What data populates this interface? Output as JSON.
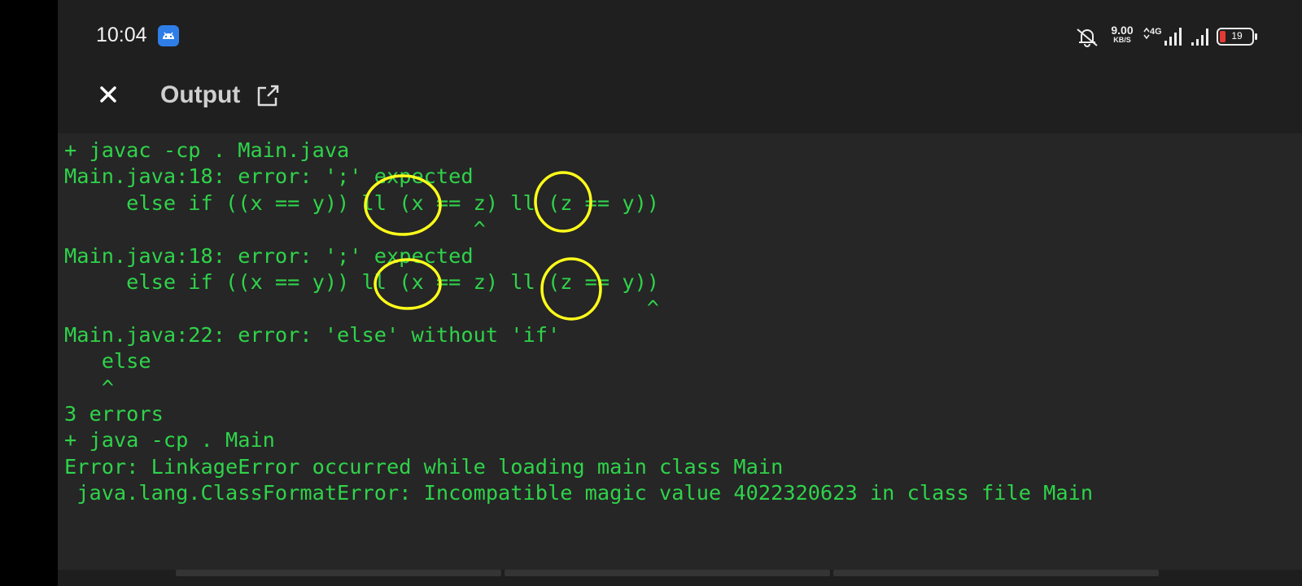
{
  "status_bar": {
    "time": "10:04",
    "notification_icon": "android-app-icon",
    "mute_icon": "bell-off-icon",
    "net_speed_value": "9.00",
    "net_speed_unit": "KB/S",
    "network_type": "4G",
    "battery_level": "19",
    "accent_color": "#2f7ee8",
    "battery_low_color": "#e53935"
  },
  "app_bar": {
    "close_icon": "close-icon",
    "title": "Output",
    "share_icon": "open-external-icon"
  },
  "console": {
    "text_color": "#2fd34a",
    "lines": [
      "+ javac -cp . Main.java",
      "Main.java:18: error: ';' expected",
      "     else if ((x == y)) ll (x == z) ll (z == y))",
      "                                 ^",
      "Main.java:18: error: ';' expected",
      "     else if ((x == y)) ll (x == z) ll (z == y))",
      "                                               ^",
      "Main.java:22: error: 'else' without 'if'",
      "   else",
      "   ^",
      "3 errors",
      "+ java -cp . Main",
      "Error: LinkageError occurred while loading main class Main",
      " java.lang.ClassFormatError: Incompatible magic value 4022320623 in class file Main"
    ]
  },
  "annotations": {
    "color": "#ffff1a",
    "shape": "hand-drawn circles highlighting the 'll' operators"
  }
}
